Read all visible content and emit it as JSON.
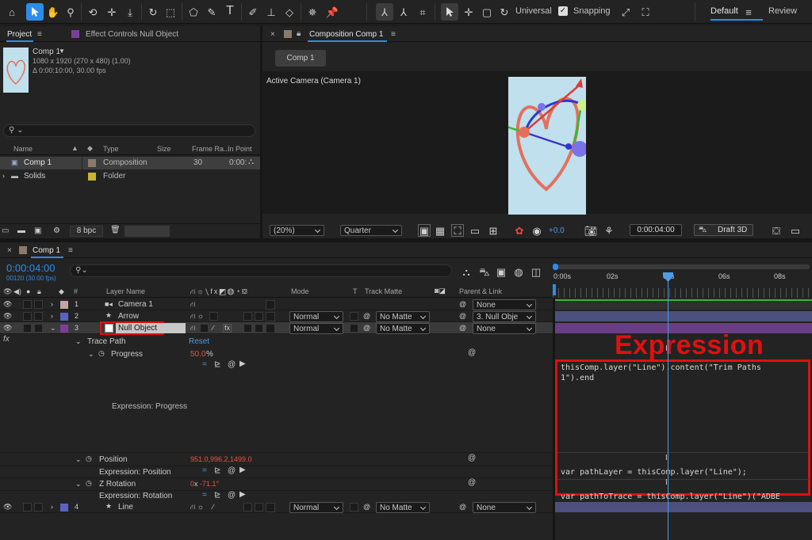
{
  "colors": {
    "accent": "#2d8ceb",
    "value_red": "#e8553e",
    "highlight": "#e01010",
    "label_violet": "#7a3f9b",
    "label_blue": "#5a63c4",
    "label_pink": "#c9a2a8"
  },
  "toolbar": {
    "universal": "Universal",
    "snapping": "Snapping",
    "workspace_default": "Default",
    "workspace_review": "Review",
    "icons": [
      "home-icon",
      "selection-arrow-icon",
      "hand-icon",
      "zoom-icon",
      "rotate-3d-icon",
      "pan-behind-icon",
      "move-down-icon",
      "rotate-icon",
      "track-camera-icon",
      "shape-icon",
      "pen-icon",
      "type-icon",
      "brush-icon",
      "clone-stamp-icon",
      "eraser-icon",
      "roto-brush-icon",
      "puppet-pin-icon",
      "axis-world-icon",
      "axis-local-icon",
      "axis-view-icon",
      "select-icon",
      "move-icon",
      "scale-icon",
      "rotate-tool-icon"
    ]
  },
  "project": {
    "tab_project": "Project",
    "tab_effect": "Effect Controls Null Object",
    "comp_name": "Comp 1",
    "comp_size": "1080 x 1920  (270 x 480) (1.00)",
    "comp_duration": "Δ 0:00:10:00, 30.00 fps",
    "search_placeholder": "",
    "columns": {
      "name": "Name",
      "type": "Type",
      "size": "Size",
      "frame_rate": "Frame Ra...",
      "in_point": "In Point"
    },
    "items": [
      {
        "name": "Comp 1",
        "type": "Composition",
        "frame_rate": "30",
        "in_point": "0:00:"
      },
      {
        "name": "Solids",
        "type": "Folder",
        "frame_rate": "",
        "in_point": ""
      }
    ],
    "bpc": "8 bpc"
  },
  "viewer": {
    "tab": "Composition Comp 1",
    "comp_button": "Comp 1",
    "active_camera": "Active Camera (Camera 1)",
    "zoom": "(20%)",
    "resolution": "Quarter",
    "exposure": "+0.0",
    "timecode": "0:00:04:00",
    "draft3d": "Draft 3D"
  },
  "timeline": {
    "tab": "Comp 1",
    "current_time": "0:00:04:00",
    "frame_info": "00120 (30.00 fps)",
    "columns": {
      "layer_name": "Layer Name",
      "mode": "Mode",
      "t": "T",
      "track_matte": "Track Matte",
      "parent": "Parent & Link",
      "num": "#"
    },
    "ruler": [
      "0:00s",
      "02s",
      "04s",
      "06s",
      "08s"
    ],
    "layers": [
      {
        "num": "1",
        "name": "Camera 1",
        "mode": "",
        "matte": "",
        "parent": "None"
      },
      {
        "num": "2",
        "name": "Arrow",
        "mode": "Normal",
        "matte": "No Matte",
        "parent": "3. Null Obje"
      },
      {
        "num": "3",
        "name": "Null Object",
        "mode": "Normal",
        "matte": "No Matte",
        "parent": "None"
      },
      {
        "num": "4",
        "name": "Line",
        "mode": "Normal",
        "matte": "No Matte",
        "parent": "None"
      }
    ],
    "effects": {
      "fx": "fx",
      "trace_path": "Trace Path",
      "reset": "Reset",
      "progress_label": "Progress",
      "progress_value": "50.0",
      "progress_unit": "%",
      "expr_progress": "Expression: Progress",
      "position_label": "Position",
      "position_value": "951.0,996.2,1499.0",
      "expr_position": "Expression: Position",
      "zrot_label": "Z Rotation",
      "zrot_value_a": "0",
      "zrot_sep": "x",
      "zrot_value_b": "-71.1°",
      "expr_rotation": "Expression: Rotation"
    },
    "expressions": {
      "progress": "thisComp.layer(\"Line\").content(\"Trim Paths\n1\").end",
      "position": "var pathLayer = thisComp.layer(\"Line\");",
      "rotation": "var pathToTrace = thisComp.layer(\"Line\")(\"ADBE"
    },
    "annotation": "Expression"
  }
}
